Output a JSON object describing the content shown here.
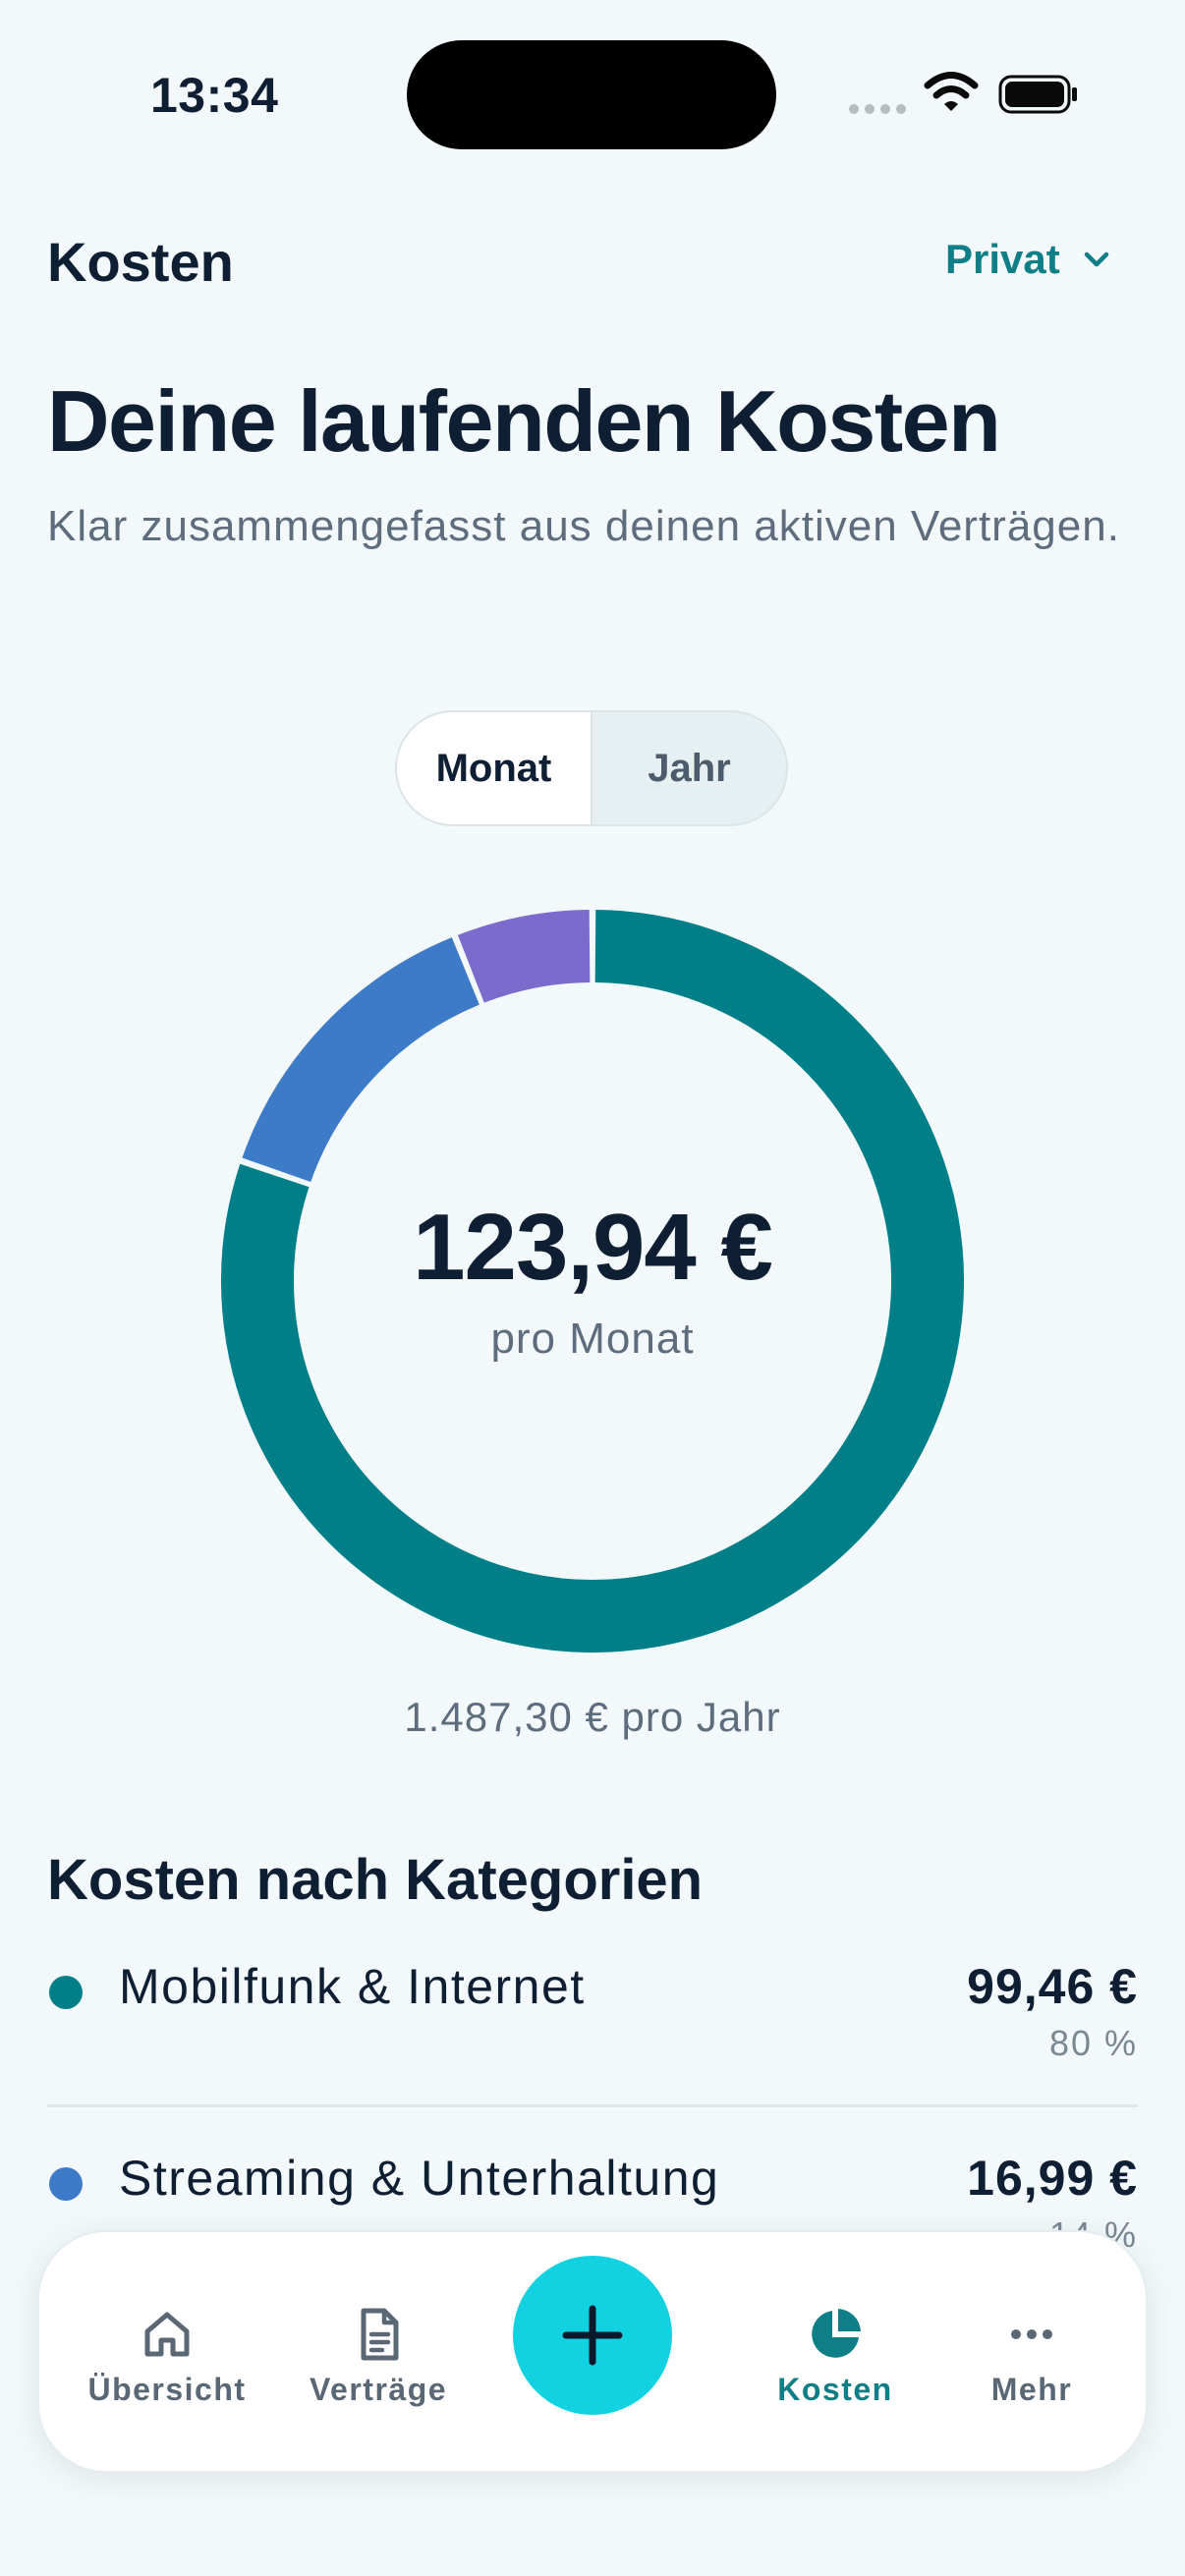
{
  "status_bar": {
    "time": "13:34"
  },
  "header": {
    "title": "Kosten",
    "account": "Privat"
  },
  "intro": {
    "headline": "Deine laufenden Kosten",
    "subline": "Klar zusammengefasst aus deinen aktiven Verträgen."
  },
  "period_toggle": {
    "options": [
      "Monat",
      "Jahr"
    ],
    "selected": "Monat"
  },
  "summary": {
    "total": "123,94 €",
    "period": "pro Monat",
    "yearly": "1.487,30 € pro Jahr"
  },
  "chart_data": {
    "type": "pie",
    "donut": true,
    "total": 123.94,
    "slices": [
      {
        "label": "Mobilfunk & Internet",
        "value": 99.46,
        "color": "#007f88"
      },
      {
        "label": "Streaming & Unterhaltung",
        "value": 16.99,
        "color": "#3d7ac8"
      },
      {
        "label": "",
        "value": 7.49,
        "color": "#7a6bcc"
      }
    ]
  },
  "categories": {
    "title": "Kosten nach Kategorien",
    "items": [
      {
        "name": "Mobilfunk & Internet",
        "amount": "99,46 €",
        "percent": "80 %",
        "color": "#007f88"
      },
      {
        "name": "Streaming & Unterhaltung",
        "amount": "16,99 €",
        "percent": "14 %",
        "color": "#3d7ac8"
      }
    ]
  },
  "tabbar": {
    "items": [
      {
        "label": "Übersicht",
        "icon": "home-icon"
      },
      {
        "label": "Verträge",
        "icon": "document-icon"
      },
      {
        "label": "",
        "icon": "plus-icon"
      },
      {
        "label": "Kosten",
        "icon": "pie-chart-icon",
        "active": true
      },
      {
        "label": "Mehr",
        "icon": "more-icon"
      }
    ]
  },
  "colors": {
    "accent": "#0e7f86",
    "fab": "#12d2e2",
    "background": "#f3f9fa",
    "text": "#0f1f33"
  }
}
